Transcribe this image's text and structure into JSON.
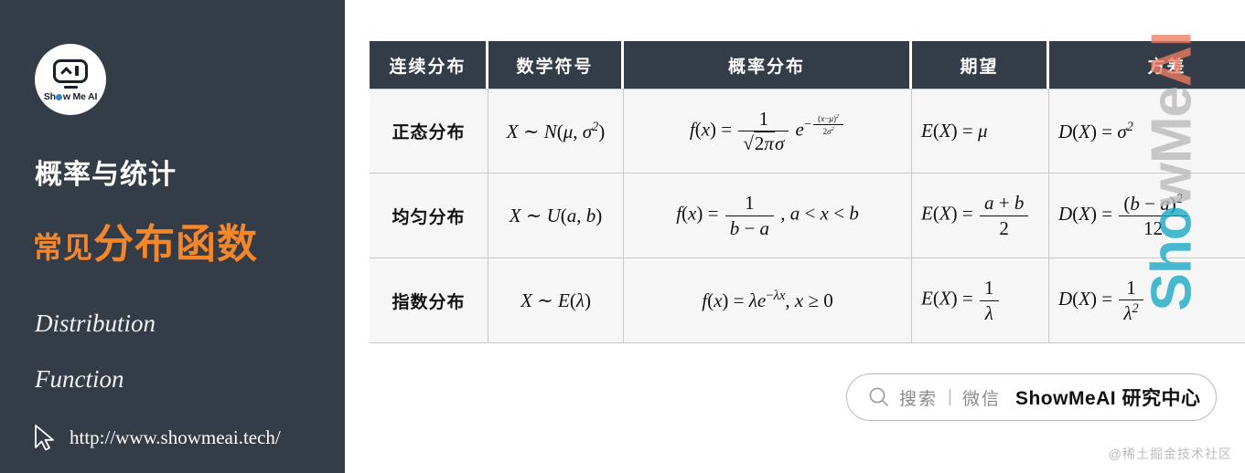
{
  "sidebar": {
    "logo": {
      "icon_name": "showmeai-robot-logo",
      "text_before": "Sh",
      "text_after": "w Me AI"
    },
    "title": "概率与统计",
    "headline_small": "常见",
    "headline_big": "分布函数",
    "english_line1": "Distribution",
    "english_line2": "Function",
    "url": "http://www.showmeai.tech/",
    "cursor_icon": "cursor-arrow-icon",
    "background_color": "#343c47",
    "accent_color": "#f5862a"
  },
  "table": {
    "headers": [
      "连续分布",
      "数学符号",
      "概率分布",
      "期望",
      "方差"
    ],
    "header_bg": "#343c47",
    "row_bg": "#f6f6f6",
    "rows": [
      {
        "name": "正态分布",
        "symbol_plain": "X ~ N(μ, σ²)",
        "pdf_plain": "f(x) = 1/(√(2π)σ) · e^(−(x−μ)²/(2σ²))",
        "expectation_plain": "E(X) = μ",
        "variance_plain": "D(X) = σ²"
      },
      {
        "name": "均匀分布",
        "symbol_plain": "X ~ U(a, b)",
        "pdf_plain": "f(x) = 1/(b−a), a < x < b",
        "expectation_plain": "E(X) = (a+b)/2",
        "variance_plain": "D(X) = (b−a)²/12"
      },
      {
        "name": "指数分布",
        "symbol_plain": "X ~ E(λ)",
        "pdf_plain": "f(x) = λe^(−λx), x ≥ 0",
        "expectation_plain": "E(X) = 1/λ",
        "variance_plain": "D(X) = 1/λ²"
      }
    ]
  },
  "search_pill": {
    "icon": "search-icon",
    "label": "搜索",
    "separator": "|",
    "channel": "微信",
    "brand": "ShowMeAI 研究中心"
  },
  "attribution": "@稀土掘金技术社区",
  "watermark": {
    "part1": "Sho",
    "part2": "wMe",
    "part3": "AI"
  }
}
